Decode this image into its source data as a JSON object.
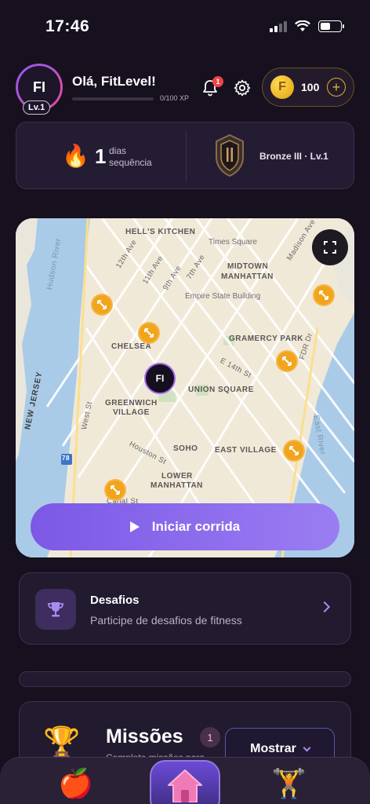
{
  "status_bar": {
    "time": "17:46"
  },
  "header": {
    "avatar_initials": "FI",
    "level_badge": "Lv.1",
    "greeting": "Olá, FitLevel!",
    "xp_text": "0/100 XP",
    "xp_progress": 0,
    "notification_count": "1",
    "coins": "100",
    "coin_symbol": "F",
    "add_symbol": "+"
  },
  "streak": {
    "count": "1",
    "label": "dias sequência",
    "rank": "Bronze III · Lv.1"
  },
  "map": {
    "labels": {
      "hells_kitchen": "HELL'S KITCHEN",
      "times_square": "Times Square",
      "midtown": "MIDTOWN",
      "manhattan": "MANHATTAN",
      "empire_state": "Empire State Building",
      "chelsea": "CHELSEA",
      "gramercy": "GRAMERCY PARK",
      "union_square": "UNION SQUARE",
      "greenwich": "GREENWICH",
      "village": "VILLAGE",
      "soho": "SOHO",
      "east_village": "EAST VILLAGE",
      "lower": "LOWER",
      "lower_manhattan": "MANHATTAN",
      "hudson_river": "Hudson River",
      "east_river": "East River",
      "new_jersey": "NEW JERSEY",
      "twelfth_ave": "12th Ave",
      "eleventh_ave": "11th Ave",
      "ninth_ave": "9th Ave",
      "seventh_ave": "7th Ave",
      "madison_ave": "Madison Ave",
      "fdr_dr": "FDR Dr",
      "e14th_st": "E 14th St",
      "west_st": "West St",
      "houston_st": "Houston St",
      "canal_st": "Canal St",
      "route_78": "78"
    },
    "user_initials": "FI",
    "start_button": "Iniciar corrida"
  },
  "challenges": {
    "title": "Desafios",
    "subtitle": "Participe de desafios de fitness"
  },
  "missions": {
    "title": "Missões",
    "count": "1",
    "subtitle": "Complete missões para",
    "show_button": "Mostrar"
  },
  "colors": {
    "background": "#17101f",
    "accent": "#8b68ec",
    "coin": "#f2b21c",
    "marker": "#f2a51c"
  }
}
